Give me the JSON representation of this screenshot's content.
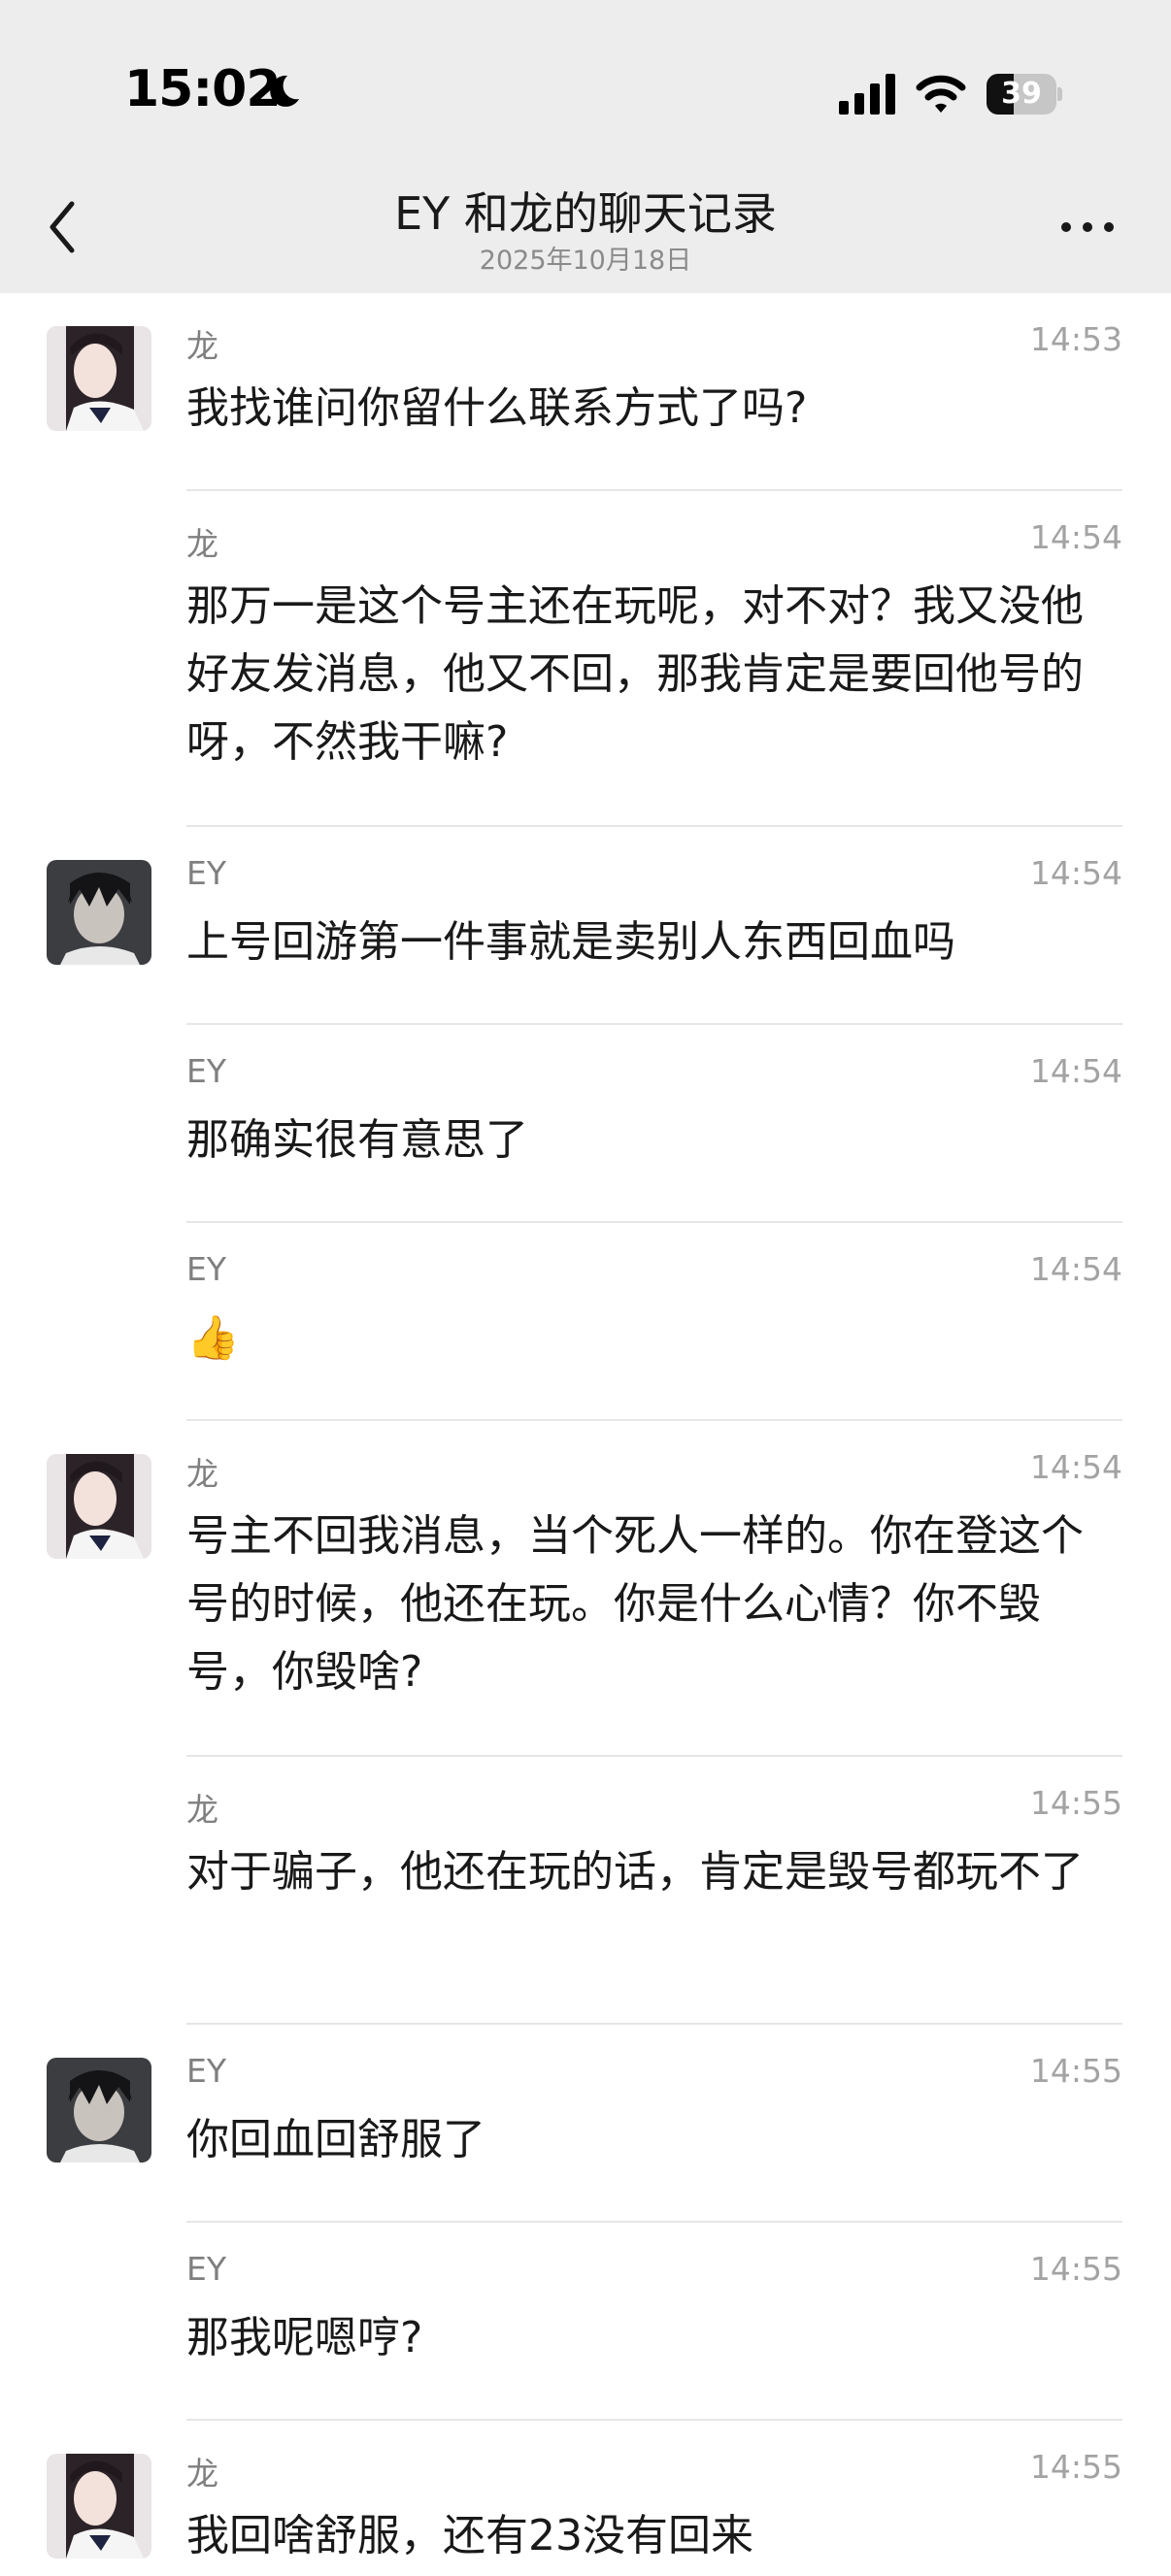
{
  "status_bar": {
    "time": "15:02",
    "battery": "39",
    "battery_level": 0.39
  },
  "nav": {
    "title": "EY 和龙的聊天记录",
    "subtitle": "2025年10月18日"
  },
  "messages": [
    {
      "sender": "龙",
      "time": "14:53",
      "text": "我找谁问你留什么联系方式了吗?",
      "avatar": "girl-avatar"
    },
    {
      "sender": "龙",
      "time": "14:54",
      "text": "那万一是这个号主还在玩呢，对不对？我又没他好友发消息，他又不回，那我肯定是要回他号的呀，不然我干嘛?",
      "avatar": ""
    },
    {
      "sender": "EY",
      "time": "14:54",
      "text": "上号回游第一件事就是卖别人东西回血吗",
      "avatar": "boy-avatar"
    },
    {
      "sender": "EY",
      "time": "14:54",
      "text": "那确实很有意思了",
      "avatar": ""
    },
    {
      "sender": "EY",
      "time": "14:54",
      "text": "👍",
      "avatar": ""
    },
    {
      "sender": "龙",
      "time": "14:54",
      "text": "号主不回我消息，当个死人一样的。你在登这个号的时候，他还在玩。你是什么心情？你不毁号，你毁啥?",
      "avatar": "girl-avatar"
    },
    {
      "sender": "龙",
      "time": "14:55",
      "text": "对于骗子，他还在玩的话，肯定是毁号都玩不了",
      "avatar": ""
    },
    {
      "sender": "EY",
      "time": "14:55",
      "text": "你回血回舒服了",
      "avatar": "boy-avatar"
    },
    {
      "sender": "EY",
      "time": "14:55",
      "text": "那我呢嗯哼?",
      "avatar": ""
    },
    {
      "sender": "龙",
      "time": "14:55",
      "text": "我回啥舒服，还有23没有回来",
      "avatar": "girl-avatar"
    }
  ]
}
